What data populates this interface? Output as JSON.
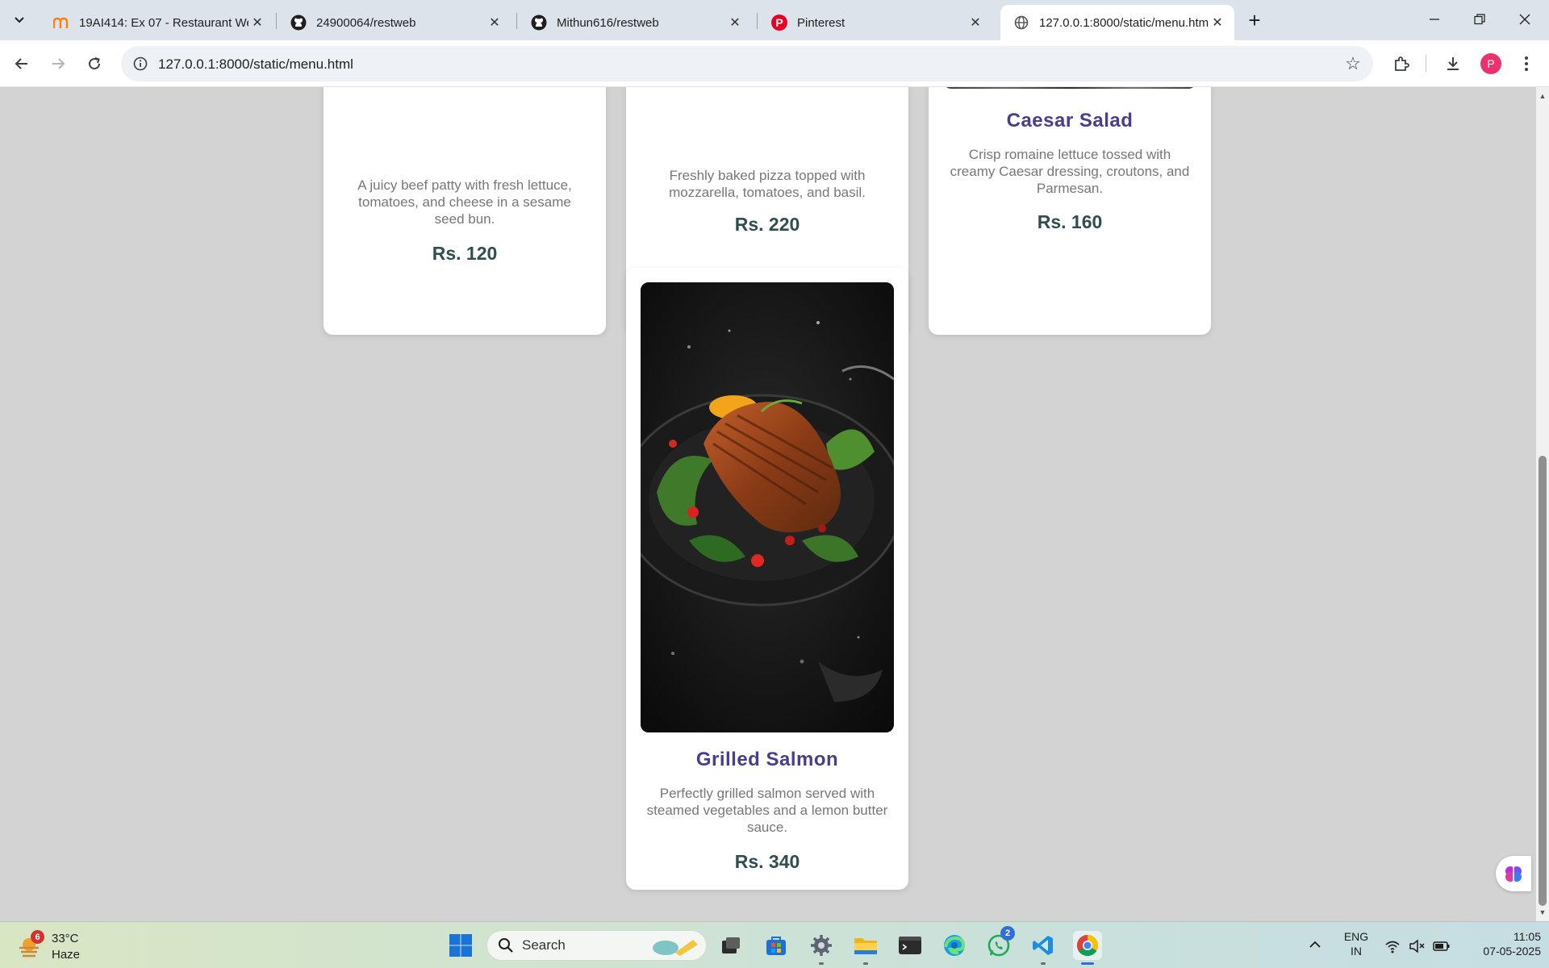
{
  "browser": {
    "tabs": [
      {
        "title": "19AI414: Ex 07 - Restaurant We",
        "favicon": "moodle-icon"
      },
      {
        "title": "24900064/restweb",
        "favicon": "github-icon"
      },
      {
        "title": "Mithun616/restweb",
        "favicon": "github-icon"
      },
      {
        "title": "Pinterest",
        "favicon": "pinterest-icon"
      },
      {
        "title": "127.0.0.1:8000/static/menu.htm",
        "favicon": "globe-icon"
      }
    ],
    "active_tab_index": 4,
    "url": "127.0.0.1:8000/static/menu.html",
    "profile_initial": "P"
  },
  "menu": {
    "items": [
      {
        "name": "",
        "description": "A juicy beef patty with fresh lettuce, tomatoes, and cheese in a sesame seed bun.",
        "price": "Rs. 120"
      },
      {
        "name": "",
        "description": "Freshly baked pizza topped with mozzarella, tomatoes, and basil.",
        "price": "Rs. 220"
      },
      {
        "name": "Caesar Salad",
        "description": "Crisp romaine lettuce tossed with creamy Caesar dressing, croutons, and Parmesan.",
        "price": "Rs. 160"
      },
      {
        "name": "Grilled Salmon",
        "description": "Perfectly grilled salmon served with steamed vegetables and a lemon butter sauce.",
        "price": "Rs. 340",
        "image": "grilled salmon on dark plate"
      }
    ]
  },
  "taskbar": {
    "weather": {
      "temp": "33°C",
      "condition": "Haze",
      "badge": "6"
    },
    "search_placeholder": "Search",
    "whatsapp_badge": "2",
    "language": {
      "line1": "ENG",
      "line2": "IN"
    },
    "time": "11:05",
    "date": "07-05-2025"
  },
  "colors": {
    "page_bg": "#d3d3d3",
    "item_name": "#4b3c8c",
    "price": "#2f4f4f",
    "description": "#777777"
  }
}
